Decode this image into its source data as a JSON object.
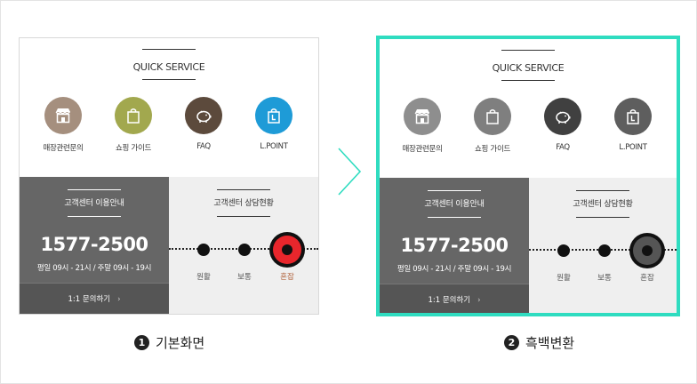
{
  "colors": {
    "accent_frame": "#2fdcc0",
    "arrow": "#2fdcc0",
    "cs_bg": "#666666",
    "cs_btn_bg": "#555555",
    "status_bg": "#efefef",
    "congested_color": "#e8262c",
    "congested_label_color": "#b0613a",
    "gray_congested": "#555555"
  },
  "panels": [
    {
      "id": "basic",
      "quick_service": {
        "title": "QUICK SERVICE",
        "items": [
          {
            "label": "매장관련문의",
            "icon": "store-icon",
            "color": "#a58f7e"
          },
          {
            "label": "쇼핑 가이드",
            "icon": "shopping-bag-icon",
            "color": "#a2a84e"
          },
          {
            "label": "FAQ",
            "icon": "piggy-bank-icon",
            "color": "#5c4a3c"
          },
          {
            "label": "L.POINT",
            "icon": "lpoint-bag-icon",
            "color": "#1e9bd7"
          }
        ]
      },
      "customer_center": {
        "title": "고객센터 이용안내",
        "phone": "1577-2500",
        "hours": "평일 09시 - 21시 / 주말 09시 - 19시",
        "button": "1:1 문의하기",
        "chevron": "›"
      },
      "status": {
        "title": "고객센터 상담현황",
        "levels": [
          "원활",
          "보통",
          "혼잡"
        ],
        "current_level": "혼잡"
      },
      "caption": {
        "number": "1",
        "text": "기본화면"
      }
    },
    {
      "id": "grayscale",
      "quick_service": {
        "title": "QUICK SERVICE",
        "items": [
          {
            "label": "매장관련문의",
            "icon": "store-icon",
            "color": "#8e8e8e"
          },
          {
            "label": "쇼핑 가이드",
            "icon": "shopping-bag-icon",
            "color": "#7f7f7f"
          },
          {
            "label": "FAQ",
            "icon": "piggy-bank-icon",
            "color": "#404040"
          },
          {
            "label": "L.POINT",
            "icon": "lpoint-bag-icon",
            "color": "#5e5e5e"
          }
        ]
      },
      "customer_center": {
        "title": "고객센터 이용안내",
        "phone": "1577-2500",
        "hours": "평일 09시 - 21시 / 주말 09시 - 19시",
        "button": "1:1 문의하기",
        "chevron": "›"
      },
      "status": {
        "title": "고객센터 상담현황",
        "levels": [
          "원활",
          "보통",
          "혼잡"
        ],
        "current_level": "혼잡"
      },
      "caption": {
        "number": "2",
        "text": "흑백변환"
      }
    }
  ]
}
